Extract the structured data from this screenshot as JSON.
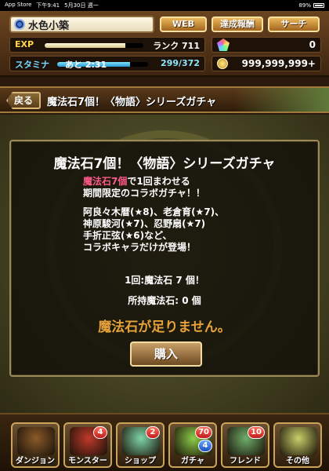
{
  "status_bar": {
    "carrier": "App Store",
    "time": "下午9:41",
    "date": "5月30日 週一",
    "battery": "89%"
  },
  "player": {
    "name": "水色小築",
    "web_button": "WEB",
    "achievements_button": "達成報酬",
    "search_button": "サーチ",
    "exp_label": "EXP",
    "exp_progress": 0.82,
    "rank_text": "ランク 711",
    "stamina_label": "スタミナ",
    "stamina_timer": "あと 2:31",
    "stamina_text": "299/372",
    "stamina_progress": 0.8,
    "magic_stones": "0",
    "coins": "999,999,999+"
  },
  "title_bar": {
    "back_label": "戻る",
    "title": "魔法石7個！〈物語〉シリーズガチャ"
  },
  "dialog": {
    "title": "魔法石7個！〈物語〉シリーズガチャ",
    "line1_highlight": "魔法石7個",
    "line1_rest": "で1回まわせる",
    "line2": "期間限定のコラボガチャ！！",
    "line3": "阿良々木暦(★8)、老倉育(★7)、",
    "line4": "神原駿河(★7)、忍野扇(★7)",
    "line5": "手折正弦(★6)など、",
    "line6": "コラボキャラだけが登場！",
    "cost_line": "1回:魔法石 7 個！",
    "owned_line": "所持魔法石: 0 個",
    "warning": "魔法石が足りません。",
    "buy_button": "購入"
  },
  "bottom_nav": [
    {
      "label": "ダンジョン",
      "badge": "",
      "badge2": "",
      "icon": "dungeon-gate-icon",
      "color": "#8a5a2a"
    },
    {
      "label": "モンスター",
      "badge": "4",
      "badge2": "",
      "icon": "monster-icon",
      "color": "#c0392b"
    },
    {
      "label": "ショップ",
      "badge": "2",
      "badge2": "",
      "icon": "shop-stone-icon",
      "color": "#7fd6a8"
    },
    {
      "label": "ガチャ",
      "badge": "70",
      "badge2": "4",
      "icon": "gacha-egg-icon",
      "color": "#8ccf4a"
    },
    {
      "label": "フレンド",
      "badge": "10",
      "badge2": "",
      "icon": "friend-icon",
      "color": "#6fae6a"
    },
    {
      "label": "その他",
      "badge": "",
      "badge2": "",
      "icon": "other-ring-icon",
      "color": "#c8d06a"
    }
  ]
}
